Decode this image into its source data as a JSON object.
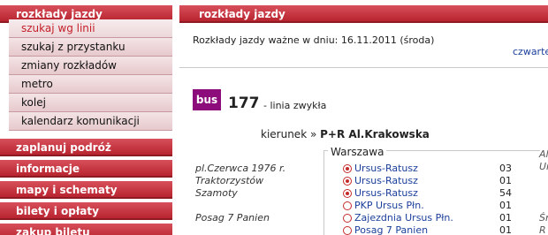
{
  "sidebar": {
    "main_title": "rozkłady jazdy",
    "sub_items": [
      {
        "label": "szukaj wg linii",
        "active": true
      },
      {
        "label": "szukaj z przystanku",
        "active": false
      },
      {
        "label": "zmiany rozkładów",
        "active": false
      },
      {
        "label": "metro",
        "active": false
      },
      {
        "label": "kolej",
        "active": false
      },
      {
        "label": "kalendarz komunikacji",
        "active": false
      }
    ],
    "sections": [
      {
        "label": "zaplanuj podróż"
      },
      {
        "label": "informacje"
      },
      {
        "label": "mapy i schematy"
      },
      {
        "label": "bilety i opłaty"
      },
      {
        "label": "zakup biletu"
      }
    ]
  },
  "content": {
    "header": "rozkłady jazdy",
    "valid_text": "Rozkłady jazdy ważne w dniu: 16.11.2011 (środa)",
    "day_link": "czwarte",
    "badge": "bus",
    "line_number": "177",
    "line_type": "- linia zwykła",
    "direction_prefix": "kierunek »",
    "direction_name": "P+R Al.Krakowska",
    "city": "Warszawa",
    "stops": [
      "pl.Czerwca 1976 r.",
      "Traktorzystów",
      "Szamoty",
      "Posag 7 Panien"
    ],
    "connections": [
      {
        "label": "Ursus-Ratusz",
        "num": "03",
        "selected": true
      },
      {
        "label": "Ursus-Ratusz",
        "num": "01",
        "selected": true
      },
      {
        "label": "Ursus-Ratusz",
        "num": "54",
        "selected": true
      },
      {
        "label": "PKP Ursus Płn.",
        "num": "01",
        "selected": false
      },
      {
        "label": "Zajezdnia Ursus Płn.",
        "num": "01",
        "selected": false
      },
      {
        "label": "Posag 7 Panien",
        "num": "01",
        "selected": false
      }
    ],
    "right_col": [
      "Al",
      "Ur",
      "Śr",
      "R"
    ]
  },
  "colors": {
    "menu_red": "#c53a44",
    "badge_purple": "#8b0c7a",
    "link_blue": "#1a3e9a",
    "active_text": "#c4202b"
  }
}
